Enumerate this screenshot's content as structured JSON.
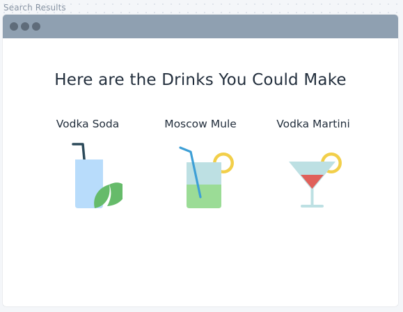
{
  "canvas": {
    "label": "Search Results"
  },
  "window": {
    "controls": [
      "window-dot-1",
      "window-dot-2",
      "window-dot-3"
    ]
  },
  "main": {
    "heading": "Here are the Drinks You Could Make",
    "drinks": [
      {
        "name": "Vodka Soda",
        "icon": "vodka-soda-icon"
      },
      {
        "name": "Moscow Mule",
        "icon": "moscow-mule-icon"
      },
      {
        "name": "Vodka Martini",
        "icon": "vodka-martini-icon"
      }
    ]
  },
  "colors": {
    "titlebar": "#8fa0b1",
    "window_dots": "#5f6c7a",
    "heading_text": "#222e3c",
    "soda_glass": "#b8dcfb",
    "straw_dark": "#2c4a5a",
    "mint_leaf": "#66bb6a",
    "mule_liquid": "#9bdc96",
    "mule_glass": "#bde0e3",
    "straw_blue": "#3d9fd6",
    "lemon": "#f2cf4a",
    "martini_glass": "#bde0e3",
    "martini_liquid": "#e0605a"
  }
}
